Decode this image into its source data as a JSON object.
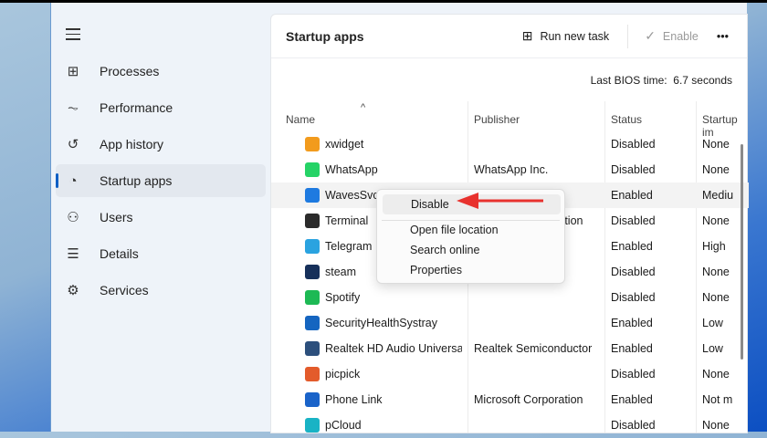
{
  "sidebar": {
    "items": [
      {
        "label": "Processes",
        "icon": "processes-icon",
        "glyph": "⊞"
      },
      {
        "label": "Performance",
        "icon": "performance-icon",
        "glyph": "⏦"
      },
      {
        "label": "App history",
        "icon": "history-icon",
        "glyph": "↺"
      },
      {
        "label": "Startup apps",
        "icon": "startup-icon",
        "glyph": "◔",
        "selected": true
      },
      {
        "label": "Users",
        "icon": "users-icon",
        "glyph": "⚇"
      },
      {
        "label": "Details",
        "icon": "details-icon",
        "glyph": "☰"
      },
      {
        "label": "Services",
        "icon": "services-icon",
        "glyph": "⚙"
      }
    ]
  },
  "header": {
    "title": "Startup apps",
    "run_new_task": "Run new task",
    "enable": "Enable",
    "more": "•••"
  },
  "bios": {
    "label": "Last BIOS time:",
    "value": "6.7 seconds"
  },
  "columns": {
    "name": "Name",
    "publisher": "Publisher",
    "status": "Status",
    "impact": "Startup im"
  },
  "rows": [
    {
      "name": "xwidget",
      "publisher": "",
      "status": "Disabled",
      "impact": "None",
      "color": "#f29b1d"
    },
    {
      "name": "WhatsApp",
      "publisher": "WhatsApp Inc.",
      "status": "Disabled",
      "impact": "None",
      "color": "#25d366"
    },
    {
      "name": "WavesSvc64",
      "publisher": "",
      "status": "Enabled",
      "impact": "Mediu",
      "color": "#1e7ae0"
    },
    {
      "name": "Terminal",
      "publisher": "Microsoft Corporation",
      "status": "Disabled",
      "impact": "None",
      "color": "#2b2b2b"
    },
    {
      "name": "Telegram",
      "publisher": "",
      "status": "Enabled",
      "impact": "High",
      "color": "#2aa3e0"
    },
    {
      "name": "steam",
      "publisher": "",
      "status": "Disabled",
      "impact": "None",
      "color": "#16305a"
    },
    {
      "name": "Spotify",
      "publisher": "",
      "status": "Disabled",
      "impact": "None",
      "color": "#1db954"
    },
    {
      "name": "SecurityHealthSystray",
      "publisher": "",
      "status": "Enabled",
      "impact": "Low",
      "color": "#1565c0"
    },
    {
      "name": "Realtek HD Audio Universa...",
      "publisher": "Realtek Semiconductor",
      "status": "Enabled",
      "impact": "Low",
      "color": "#2c4f7c"
    },
    {
      "name": "picpick",
      "publisher": "",
      "status": "Disabled",
      "impact": "None",
      "color": "#e35b2b"
    },
    {
      "name": "Phone Link",
      "publisher": "Microsoft Corporation",
      "status": "Enabled",
      "impact": "Not m",
      "color": "#1a63c9"
    },
    {
      "name": "pCloud",
      "publisher": "",
      "status": "Disabled",
      "impact": "None",
      "color": "#19b3c5"
    }
  ],
  "context_menu": {
    "items": [
      "Disable",
      "Open file location",
      "Search online",
      "Properties"
    ]
  },
  "annotation": {
    "arrow_color": "#e8322e"
  }
}
